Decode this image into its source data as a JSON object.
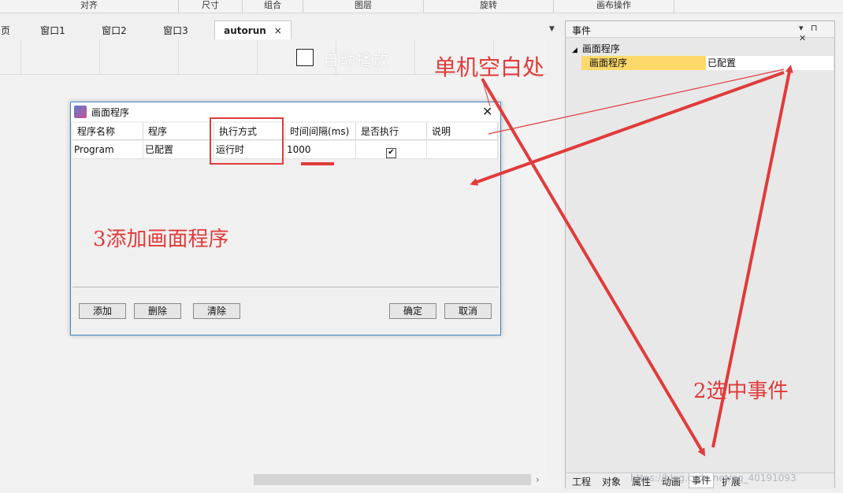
{
  "ribbon": {
    "groups": [
      "对齐",
      "尺寸",
      "组合",
      "图层",
      "旋转",
      "画布操作"
    ]
  },
  "tabs": {
    "partial": "页",
    "items": [
      "窗口1",
      "窗口2",
      "窗口3"
    ],
    "active": "autorun",
    "close": "×",
    "dropdown": "▼"
  },
  "canvas": {
    "autoplay_label": "自动播放",
    "scroll_right": "›"
  },
  "dialog": {
    "title": "画面程序",
    "close": "✕",
    "columns": [
      "程序名称",
      "程序",
      "执行方式",
      "时间间隔(ms)",
      "是否执行",
      "说明"
    ],
    "rows": [
      {
        "name": "Program",
        "program": "已配置",
        "mode": "运行时",
        "interval": "1000",
        "enabled_mark": "✔",
        "note": ""
      }
    ],
    "buttons": {
      "add": "添加",
      "delete": "删除",
      "clear": "清除",
      "ok": "确定",
      "cancel": "取消"
    }
  },
  "panel": {
    "title": "事件",
    "controls": "▾ ⊓ ✕",
    "tree_arrow": "◢",
    "tree_node": "画面程序",
    "property": {
      "name": "画面程序",
      "value": "已配置"
    },
    "tabs": [
      "工程",
      "对象",
      "属性",
      "动画",
      "事件",
      "扩展"
    ],
    "active_tab": "事件"
  },
  "annotations": {
    "step1": "单机空白处",
    "step2": "2选中事件",
    "step3": "3添加画面程序"
  },
  "watermark": "https://blog.csdn.net/qq_40191093",
  "colors": {
    "annotation": "#e03b3b",
    "selection": "#fcd96a",
    "dialog_border": "#3d87c6"
  }
}
